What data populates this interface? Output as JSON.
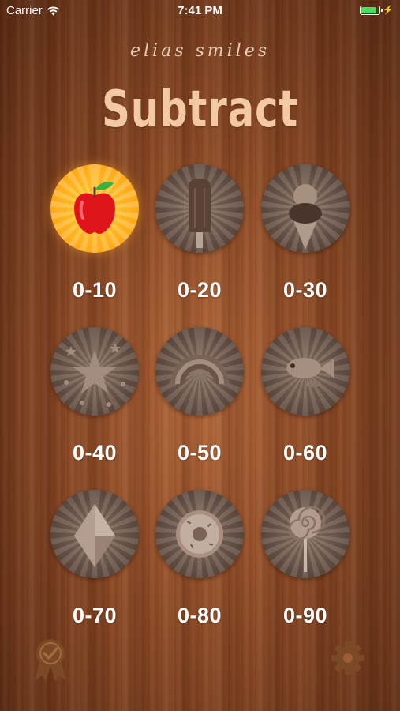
{
  "status_bar": {
    "carrier": "Carrier",
    "time": "7:41 PM"
  },
  "header": {
    "brand": "elias smiles",
    "title": "Subtract"
  },
  "levels": [
    {
      "label": "0-10",
      "icon": "apple-icon",
      "unlocked": true
    },
    {
      "label": "0-20",
      "icon": "popsicle-icon",
      "unlocked": false
    },
    {
      "label": "0-30",
      "icon": "ice-cream-icon",
      "unlocked": false
    },
    {
      "label": "0-40",
      "icon": "star-icon",
      "unlocked": false
    },
    {
      "label": "0-50",
      "icon": "rainbow-icon",
      "unlocked": false
    },
    {
      "label": "0-60",
      "icon": "fish-icon",
      "unlocked": false
    },
    {
      "label": "0-70",
      "icon": "diamond-icon",
      "unlocked": false
    },
    {
      "label": "0-80",
      "icon": "donut-icon",
      "unlocked": false
    },
    {
      "label": "0-90",
      "icon": "lollipop-icon",
      "unlocked": false
    }
  ],
  "footer": {
    "left_icon": "award-ribbon-icon",
    "right_icon": "gear-icon"
  },
  "colors": {
    "title": "#f2c9a3",
    "active_badge": "#ffc22a",
    "locked_badge": "#6b564a",
    "battery": "#4cd964"
  }
}
